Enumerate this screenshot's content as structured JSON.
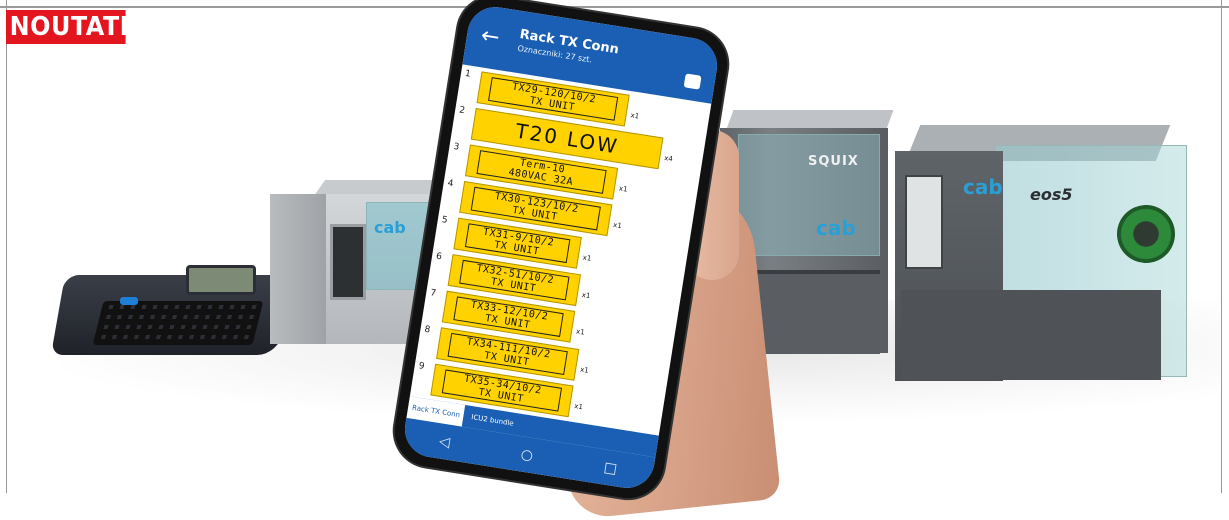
{
  "badge": {
    "text": "NOUTATE"
  },
  "printers": {
    "small_logo": "cab",
    "squix_name": "SQUIX",
    "squix_logo": "cab",
    "eos_logo": "cab",
    "eos_model": "eos5"
  },
  "phone": {
    "title": "Rack TX Conn",
    "subtitle": "Oznaczniki: 27 szt.",
    "back_icon": "arrow-left-icon",
    "print_icon": "printer-icon",
    "labels": [
      {
        "num": "1",
        "line1": "TX29-120/10/2",
        "line2": "TX UNIT",
        "mult": "x1"
      },
      {
        "num": "2",
        "line1": "T20 LOW",
        "line2": "",
        "mult": "x4"
      },
      {
        "num": "3",
        "line1": "Term-10",
        "line2": "480VAC 32A",
        "mult": "x1"
      },
      {
        "num": "4",
        "line1": "TX30-123/10/2",
        "line2": "TX UNIT",
        "mult": "x1"
      },
      {
        "num": "5",
        "line1": "TX31-9/10/2",
        "line2": "TX UNIT",
        "mult": "x1"
      },
      {
        "num": "6",
        "line1": "TX32-51/10/2",
        "line2": "TX UNIT",
        "mult": "x1"
      },
      {
        "num": "7",
        "line1": "TX33-12/10/2",
        "line2": "TX UNIT",
        "mult": "x1"
      },
      {
        "num": "8",
        "line1": "TX34-111/10/2",
        "line2": "TX UNIT",
        "mult": "x1"
      },
      {
        "num": "9",
        "line1": "TX35-34/10/2",
        "line2": "TX UNIT",
        "mult": "x1"
      }
    ],
    "tabs": [
      "Rack TX Conn",
      "ICU2 bundle"
    ],
    "nav": [
      "◁",
      "○",
      "□"
    ]
  },
  "colors": {
    "badge": "#e3161f",
    "appbar": "#1a5fb4",
    "label": "#ffd200",
    "cab_blue": "#2a9fd6"
  }
}
